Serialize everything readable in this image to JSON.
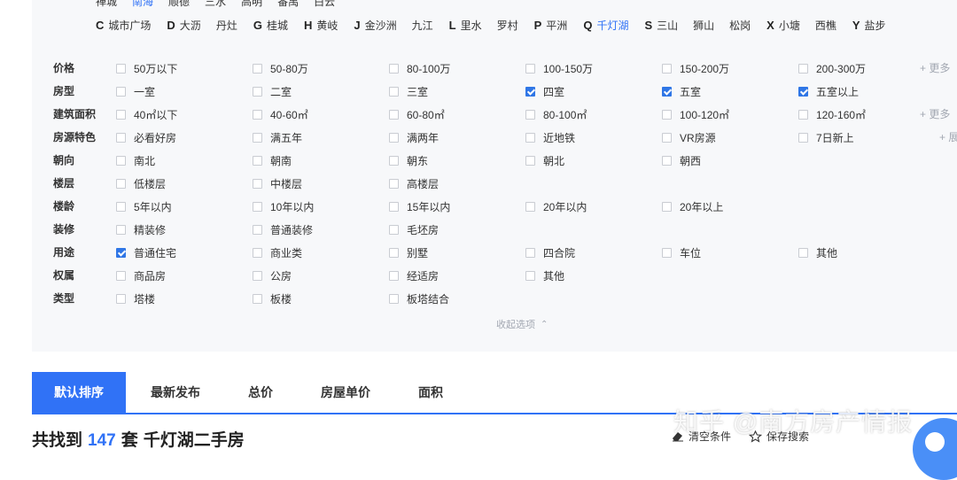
{
  "areas_top": [
    {
      "label": "禅城",
      "selected": false
    },
    {
      "label": "南海",
      "selected": true
    },
    {
      "label": "顺德",
      "selected": false
    },
    {
      "label": "三水",
      "selected": false
    },
    {
      "label": "高明",
      "selected": false
    },
    {
      "label": "番禺",
      "selected": false
    },
    {
      "label": "白云",
      "selected": false
    }
  ],
  "areas_second": [
    {
      "letter": "C",
      "items": [
        {
          "label": "城市广场",
          "selected": false
        }
      ]
    },
    {
      "letter": "D",
      "items": [
        {
          "label": "大沥",
          "selected": false
        },
        {
          "label": "丹灶",
          "selected": false
        }
      ]
    },
    {
      "letter": "G",
      "items": [
        {
          "label": "桂城",
          "selected": false
        }
      ]
    },
    {
      "letter": "H",
      "items": [
        {
          "label": "黄岐",
          "selected": false
        }
      ]
    },
    {
      "letter": "J",
      "items": [
        {
          "label": "金沙洲",
          "selected": false
        },
        {
          "label": "九江",
          "selected": false
        }
      ]
    },
    {
      "letter": "L",
      "items": [
        {
          "label": "里水",
          "selected": false
        },
        {
          "label": "罗村",
          "selected": false
        }
      ]
    },
    {
      "letter": "P",
      "items": [
        {
          "label": "平洲",
          "selected": false
        }
      ]
    },
    {
      "letter": "Q",
      "items": [
        {
          "label": "千灯湖",
          "selected": true
        }
      ]
    },
    {
      "letter": "S",
      "items": [
        {
          "label": "三山",
          "selected": false
        },
        {
          "label": "狮山",
          "selected": false
        },
        {
          "label": "松岗",
          "selected": false
        }
      ]
    },
    {
      "letter": "X",
      "items": [
        {
          "label": "小塘",
          "selected": false
        },
        {
          "label": "西樵",
          "selected": false
        }
      ]
    },
    {
      "letter": "Y",
      "items": [
        {
          "label": "盐步",
          "selected": false
        }
      ]
    }
  ],
  "filters": [
    {
      "name": "price",
      "label": "价格",
      "more": "+ 更多",
      "options": [
        {
          "label": "50万以下",
          "checked": false
        },
        {
          "label": "50-80万",
          "checked": false
        },
        {
          "label": "80-100万",
          "checked": false
        },
        {
          "label": "100-150万",
          "checked": false
        },
        {
          "label": "150-200万",
          "checked": false
        },
        {
          "label": "200-300万",
          "checked": false
        }
      ]
    },
    {
      "name": "layout",
      "label": "房型",
      "more": "",
      "options": [
        {
          "label": "一室",
          "checked": false
        },
        {
          "label": "二室",
          "checked": false
        },
        {
          "label": "三室",
          "checked": false
        },
        {
          "label": "四室",
          "checked": true
        },
        {
          "label": "五室",
          "checked": true
        },
        {
          "label": "五室以上",
          "checked": true
        }
      ]
    },
    {
      "name": "area",
      "label": "建筑面积",
      "more": "+ 更多",
      "options": [
        {
          "label": "40㎡以下",
          "checked": false
        },
        {
          "label": "40-60㎡",
          "checked": false
        },
        {
          "label": "60-80㎡",
          "checked": false
        },
        {
          "label": "80-100㎡",
          "checked": false
        },
        {
          "label": "100-120㎡",
          "checked": false
        },
        {
          "label": "120-160㎡",
          "checked": false
        }
      ]
    },
    {
      "name": "features",
      "label": "房源特色",
      "more": "+ 展",
      "options": [
        {
          "label": "必看好房",
          "checked": false
        },
        {
          "label": "满五年",
          "checked": false
        },
        {
          "label": "满两年",
          "checked": false
        },
        {
          "label": "近地铁",
          "checked": false
        },
        {
          "label": "VR房源",
          "checked": false
        },
        {
          "label": "7日新上",
          "checked": false
        }
      ]
    },
    {
      "name": "orientation",
      "label": "朝向",
      "more": "",
      "options": [
        {
          "label": "南北",
          "checked": false
        },
        {
          "label": "朝南",
          "checked": false
        },
        {
          "label": "朝东",
          "checked": false
        },
        {
          "label": "朝北",
          "checked": false
        },
        {
          "label": "朝西",
          "checked": false
        }
      ]
    },
    {
      "name": "floor",
      "label": "楼层",
      "more": "",
      "options": [
        {
          "label": "低楼层",
          "checked": false
        },
        {
          "label": "中楼层",
          "checked": false
        },
        {
          "label": "高楼层",
          "checked": false
        }
      ]
    },
    {
      "name": "age",
      "label": "楼龄",
      "more": "",
      "options": [
        {
          "label": "5年以内",
          "checked": false
        },
        {
          "label": "10年以内",
          "checked": false
        },
        {
          "label": "15年以内",
          "checked": false
        },
        {
          "label": "20年以内",
          "checked": false
        },
        {
          "label": "20年以上",
          "checked": false
        }
      ]
    },
    {
      "name": "decoration",
      "label": "装修",
      "more": "",
      "options": [
        {
          "label": "精装修",
          "checked": false
        },
        {
          "label": "普通装修",
          "checked": false
        },
        {
          "label": "毛坯房",
          "checked": false
        }
      ]
    },
    {
      "name": "usage",
      "label": "用途",
      "more": "",
      "options": [
        {
          "label": "普通住宅",
          "checked": true
        },
        {
          "label": "商业类",
          "checked": false
        },
        {
          "label": "别墅",
          "checked": false
        },
        {
          "label": "四合院",
          "checked": false
        },
        {
          "label": "车位",
          "checked": false
        },
        {
          "label": "其他",
          "checked": false
        }
      ]
    },
    {
      "name": "ownership",
      "label": "权属",
      "more": "",
      "options": [
        {
          "label": "商品房",
          "checked": false
        },
        {
          "label": "公房",
          "checked": false
        },
        {
          "label": "经适房",
          "checked": false
        },
        {
          "label": "其他",
          "checked": false
        }
      ]
    },
    {
      "name": "building-type",
      "label": "类型",
      "more": "",
      "options": [
        {
          "label": "塔楼",
          "checked": false
        },
        {
          "label": "板楼",
          "checked": false
        },
        {
          "label": "板塔结合",
          "checked": false
        }
      ]
    }
  ],
  "collapse_label": "收起选项",
  "sort_tabs": [
    {
      "label": "默认排序",
      "active": true
    },
    {
      "label": "最新发布",
      "active": false
    },
    {
      "label": "总价",
      "active": false
    },
    {
      "label": "房屋单价",
      "active": false
    },
    {
      "label": "面积",
      "active": false
    }
  ],
  "result": {
    "prefix": "共找到",
    "count": "147",
    "unit": "套",
    "suffix": "千灯湖二手房"
  },
  "actions": {
    "clear": "清空条件",
    "save": "保存搜索"
  },
  "watermark": "知乎 @南方房产情报",
  "colors": {
    "accent": "#3072f6",
    "panel_bg": "#f7f8fa",
    "muted": "#a3a8b2"
  }
}
